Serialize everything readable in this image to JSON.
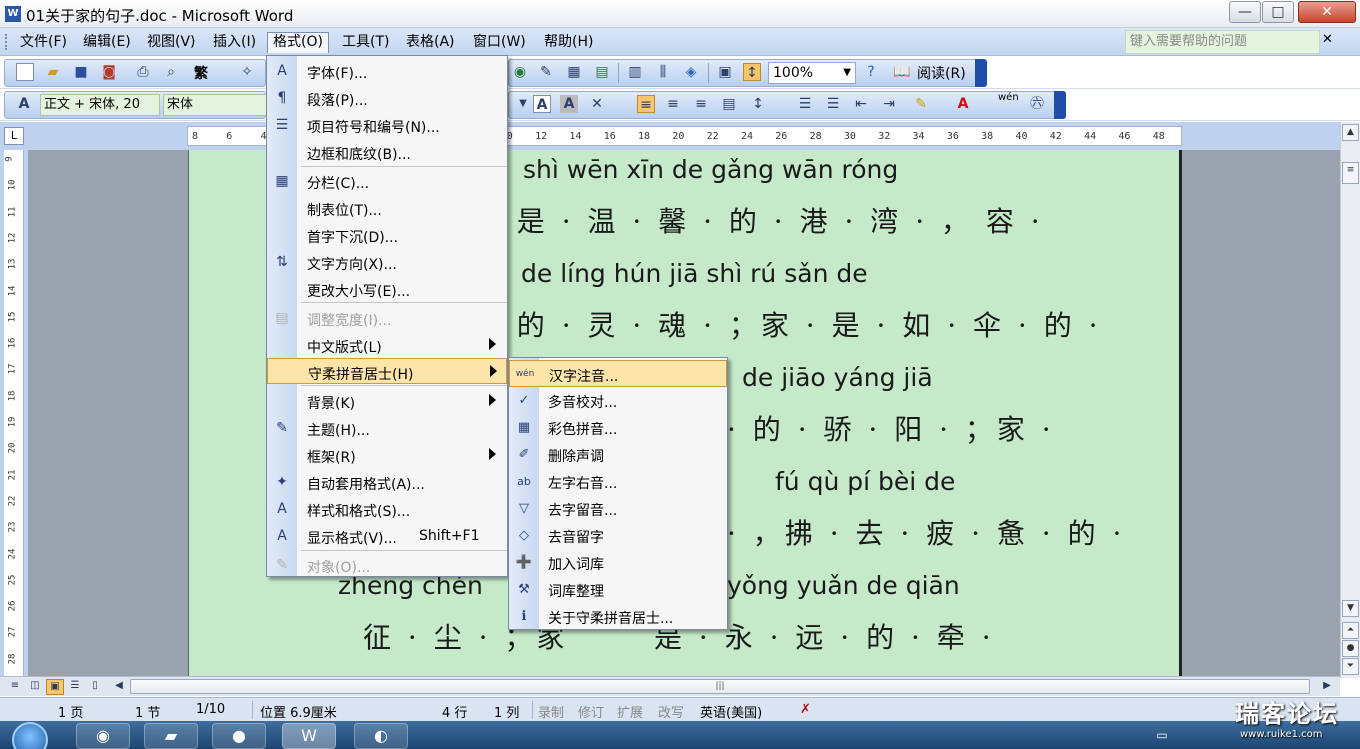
{
  "window": {
    "title": "01关于家的句子.doc - Microsoft Word",
    "app_icon": "W",
    "min_glyph": "—",
    "max_glyph": "□",
    "close_glyph": "✕"
  },
  "menubar": {
    "items": [
      "文件(F)",
      "编辑(E)",
      "视图(V)",
      "插入(I)",
      "格式(O)",
      "工具(T)",
      "表格(A)",
      "窗口(W)",
      "帮助(H)"
    ],
    "active": "格式(O)",
    "help_placeholder": "键入需要帮助的问题",
    "help_close": "✕"
  },
  "toolbar1": {
    "trad_char": "繁",
    "zoom": "100%",
    "read_label": "阅读(R)"
  },
  "toolbar2": {
    "style_value": "正文 + 宋体, 20",
    "font_value": "宋体",
    "style_icon": "A",
    "wen_icon": "wén"
  },
  "ruler": {
    "corner": "L",
    "ticks": [
      "8",
      "6",
      "4",
      "2",
      "",
      "2",
      "4",
      "6",
      "8",
      "10",
      "12",
      "14",
      "16",
      "18",
      "20",
      "22",
      "24",
      "26",
      "28",
      "30",
      "32",
      "34",
      "36",
      "38",
      "40",
      "42",
      "44",
      "46",
      "48"
    ],
    "vticks": [
      "9",
      "10",
      "11",
      "12",
      "13",
      "14",
      "15",
      "16",
      "17",
      "18",
      "19",
      "20",
      "21",
      "22",
      "23",
      "24",
      "25",
      "26",
      "27",
      "28"
    ]
  },
  "document": {
    "lines": [
      {
        "pinyin": "shì  wēn  xīn  de  gǎng  wān    róng",
        "hanzi": "· 是 · 温 · 馨 · 的 · 港 · 湾 · ， 容 ·"
      },
      {
        "pinyin": "de  líng  hún    jiā  shì  rú  sǎn  de",
        "hanzi": "· 的 · 灵 · 魂 · ；家 · 是 · 如 · 伞 · 的 ·"
      },
      {
        "pinyin": "de  jiāo  yáng    jiā",
        "hanzi": "· 的 · 骄 · 阳 · ；家 ·"
      },
      {
        "pinyin": "fú  qù  pí  bèi  de",
        "hanzi": "· ，拂 · 去 · 疲 · 惫 · 的 ·"
      },
      {
        "pinyin": "zhēng  chén",
        "hanzi": "征 · 尘 · ；家"
      },
      {
        "pinyin": "yǒng  yuǎn  de  qiān",
        "hanzi": "是 · 永 · 远 · 的 · 牵 ·"
      }
    ]
  },
  "format_menu": {
    "items": [
      {
        "label": "字体(F)...",
        "icon": "A",
        "submenu": false,
        "disabled": false
      },
      {
        "label": "段落(P)...",
        "icon": "¶",
        "submenu": false,
        "disabled": false
      },
      {
        "label": "项目符号和编号(N)...",
        "icon": "☰",
        "submenu": false,
        "disabled": false
      },
      {
        "label": "边框和底纹(B)...",
        "icon": "",
        "submenu": false,
        "disabled": false
      },
      {
        "label": "分栏(C)...",
        "icon": "▦",
        "submenu": false,
        "disabled": false
      },
      {
        "label": "制表位(T)...",
        "icon": "",
        "submenu": false,
        "disabled": false
      },
      {
        "label": "首字下沉(D)...",
        "icon": "",
        "submenu": false,
        "disabled": false
      },
      {
        "label": "文字方向(X)...",
        "icon": "⇅",
        "submenu": false,
        "disabled": false
      },
      {
        "label": "更改大小写(E)...",
        "icon": "",
        "submenu": false,
        "disabled": false
      },
      {
        "label": "调整宽度(I)...",
        "icon": "▤",
        "submenu": false,
        "disabled": true
      },
      {
        "label": "中文版式(L)",
        "icon": "",
        "submenu": true,
        "disabled": false
      },
      {
        "label": "守柔拼音居士(H)",
        "icon": "",
        "submenu": true,
        "disabled": false
      },
      {
        "label": "背景(K)",
        "icon": "",
        "submenu": true,
        "disabled": false
      },
      {
        "label": "主题(H)...",
        "icon": "✎",
        "submenu": false,
        "disabled": false
      },
      {
        "label": "框架(R)",
        "icon": "",
        "submenu": true,
        "disabled": false
      },
      {
        "label": "自动套用格式(A)...",
        "icon": "✦",
        "submenu": false,
        "disabled": false
      },
      {
        "label": "样式和格式(S)...",
        "icon": "A",
        "submenu": false,
        "disabled": false
      },
      {
        "label": "显示格式(V)...",
        "icon": "A",
        "submenu": false,
        "disabled": false,
        "shortcut": "Shift+F1"
      },
      {
        "label": "对象(O)...",
        "icon": "✎",
        "submenu": false,
        "disabled": true
      }
    ],
    "highlighted": "守柔拼音居士(H)"
  },
  "submenu": {
    "items": [
      {
        "label": "汉字注音...",
        "icon": "wén"
      },
      {
        "label": "多音校对...",
        "icon": "✓"
      },
      {
        "label": "彩色拼音...",
        "icon": "▦"
      },
      {
        "label": "删除声调",
        "icon": "✐"
      },
      {
        "label": "左字右音...",
        "icon": "ab"
      },
      {
        "label": "去字留音...",
        "icon": "▽"
      },
      {
        "label": "去音留字",
        "icon": "◇"
      },
      {
        "label": "加入词库",
        "icon": "➕"
      },
      {
        "label": "词库整理",
        "icon": "⚒"
      },
      {
        "label": "关于守柔拼音居士...",
        "icon": "ℹ"
      }
    ],
    "highlighted": "汉字注音..."
  },
  "statusbar": {
    "page": "1 页",
    "section": "1 节",
    "page_of": "1/10",
    "position": "位置 6.9厘米",
    "line": "4 行",
    "column": "1 列",
    "rec": "录制",
    "trk": "修订",
    "ext": "扩展",
    "ovr": "改写",
    "lang": "英语(美国)"
  },
  "watermark": {
    "text": "瑞客论坛",
    "url": "www.ruike1.com"
  },
  "colors": {
    "page_bg": "#c5e9c9",
    "menu_highlight": "#fde4a9",
    "toolbar_blue": "#c3d5f0"
  }
}
